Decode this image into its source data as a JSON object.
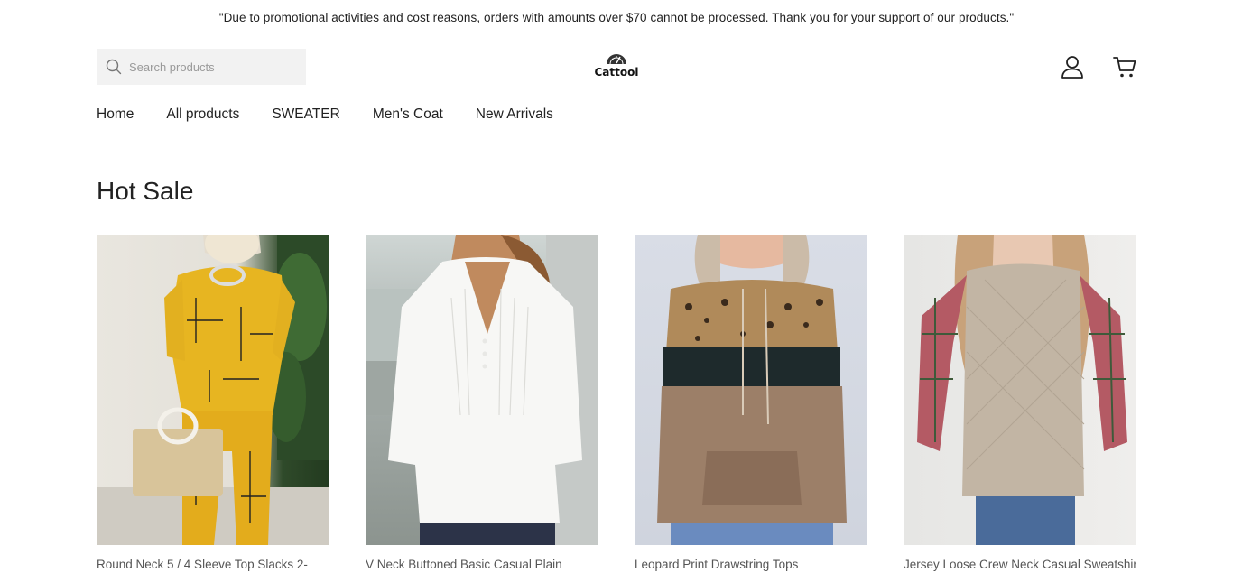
{
  "announcement": "\"Due to promotional activities and cost reasons, orders with amounts over $70 cannot be processed. Thank you for your support of our products.\"",
  "search": {
    "placeholder": "Search products"
  },
  "logo": {
    "text": "Cattool"
  },
  "header_icons": [
    "account-icon",
    "cart-icon"
  ],
  "nav": {
    "items": [
      {
        "label": "Home"
      },
      {
        "label": "All products"
      },
      {
        "label": "SWEATER"
      },
      {
        "label": "Men's Coat"
      },
      {
        "label": "New Arrivals"
      }
    ]
  },
  "section": {
    "title": "Hot Sale"
  },
  "products": [
    {
      "title": "Round Neck 5 / 4 Sleeve Top Slacks 2-"
    },
    {
      "title": "V Neck Buttoned Basic Casual Plain"
    },
    {
      "title": "Leopard Print Drawstring Tops"
    },
    {
      "title": "Jersey Loose Crew Neck Casual Sweatshirt"
    }
  ],
  "colors": {
    "text": "#222222",
    "search_bg": "#f2f2f2"
  }
}
